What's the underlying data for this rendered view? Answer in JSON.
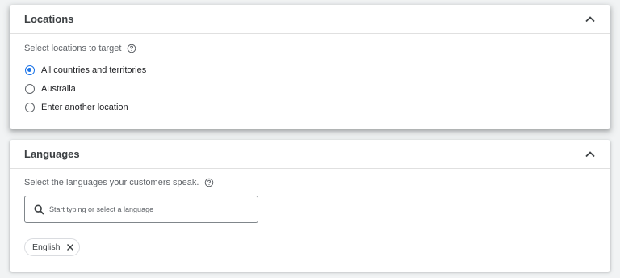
{
  "locations": {
    "title": "Locations",
    "prompt": "Select locations to target",
    "options": [
      {
        "label": "All countries and territories",
        "selected": true
      },
      {
        "label": "Australia",
        "selected": false
      },
      {
        "label": "Enter another location",
        "selected": false
      }
    ]
  },
  "languages": {
    "title": "Languages",
    "prompt": "Select the languages your customers speak.",
    "search_placeholder": "Start typing or select a language",
    "selected_chips": [
      {
        "label": "English"
      }
    ]
  },
  "colors": {
    "accent": "#1a73e8",
    "background": "#f1f3f4"
  },
  "icons": {
    "collapse": "chevron-up-icon",
    "help": "help-icon",
    "search": "search-icon",
    "remove": "close-icon"
  }
}
